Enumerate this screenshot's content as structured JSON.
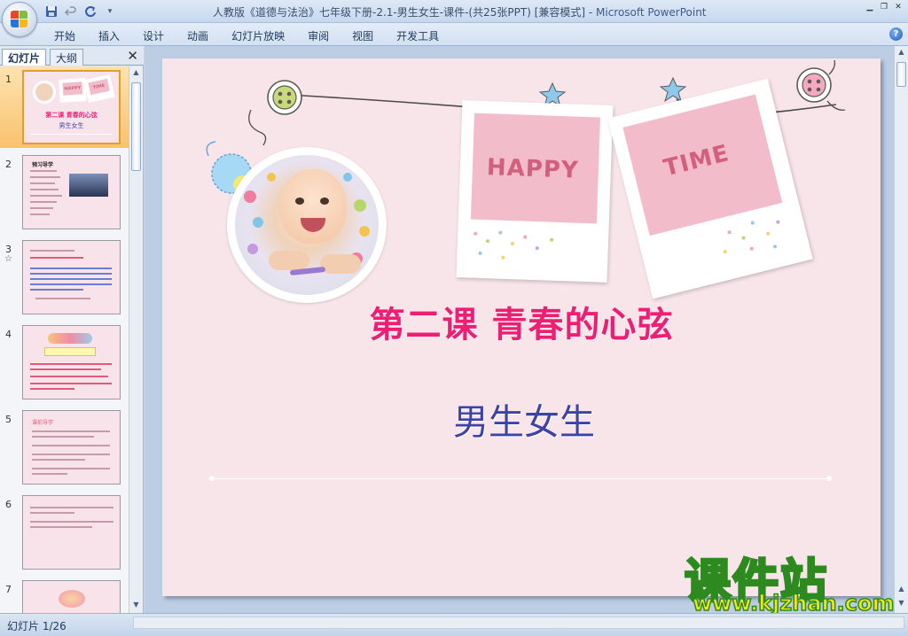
{
  "window": {
    "title": "人教版《道德与法治》七年级下册-2.1-男生女生-课件-(共25张PPT) [兼容模式]",
    "title_sep": " - ",
    "app_name": "Microsoft PowerPoint"
  },
  "quick_access": {
    "save_icon": "save-icon",
    "undo_icon": "undo-icon",
    "redo_icon": "redo-icon",
    "customize_icon": "dropdown-icon"
  },
  "ribbon": {
    "tabs": [
      "开始",
      "插入",
      "设计",
      "动画",
      "幻灯片放映",
      "审阅",
      "视图",
      "开发工具"
    ]
  },
  "left_pane": {
    "tabs": [
      "幻灯片",
      "大纲"
    ],
    "close_glyph": "✕",
    "slide_numbers": [
      "1",
      "2",
      "3",
      "4",
      "5",
      "6",
      "7"
    ],
    "slide3_marker": "☆",
    "thumb1": {
      "title": "第二课 青春的心弦",
      "sub": "男生女生",
      "happy": "HAPPY",
      "time": "TIME"
    },
    "thumb2": {
      "title": "预习导学"
    },
    "thumb5": {
      "title": "课前导学"
    }
  },
  "slide": {
    "title": "第二课  青春的心弦",
    "subtitle": "男生女生",
    "photo1_text": "HAPPY",
    "photo2_text": "TIME"
  },
  "watermark": {
    "line1": "课件站",
    "line2": "www.kjzhan.com"
  },
  "status": {
    "slide_label": "幻灯片 1/26"
  },
  "colors": {
    "slide_bg": "#f8e5ea",
    "title_color": "#ee1e73",
    "subtitle_color": "#3b43a8",
    "selected_thumb": "#f9c26e"
  }
}
